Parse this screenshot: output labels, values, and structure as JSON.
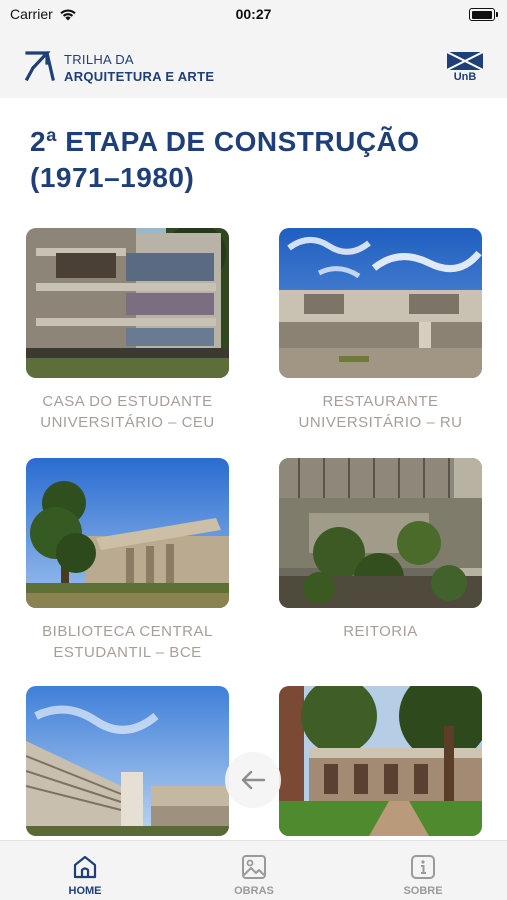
{
  "status_bar": {
    "carrier": "Carrier",
    "time": "00:27",
    "battery_level": 0.9
  },
  "header": {
    "logo_line1": "TRILHA DA",
    "logo_line2": "ARQUITETURA E ARTE",
    "unb_label": "UnB"
  },
  "page_title": "2ª ETAPA DE CONSTRUÇÃO (1971–1980)",
  "cards": [
    {
      "label": "CASA DO ESTUDANTE UNIVERSITÁRIO – CEU"
    },
    {
      "label": "RESTAURANTE UNIVERSITÁRIO – RU"
    },
    {
      "label": "BIBLIOTECA CENTRAL ESTUDANTIL – BCE"
    },
    {
      "label": "REITORIA"
    },
    {
      "label": ""
    },
    {
      "label": ""
    }
  ],
  "tabs": [
    {
      "label": "HOME",
      "icon": "home-icon",
      "active": true
    },
    {
      "label": "OBRAS",
      "icon": "image-icon",
      "active": false
    },
    {
      "label": "SOBRE",
      "icon": "info-icon",
      "active": false
    }
  ],
  "colors": {
    "brand": "#1f3f78",
    "card_label": "#a89e98",
    "header_bg": "#f4f4f4"
  }
}
